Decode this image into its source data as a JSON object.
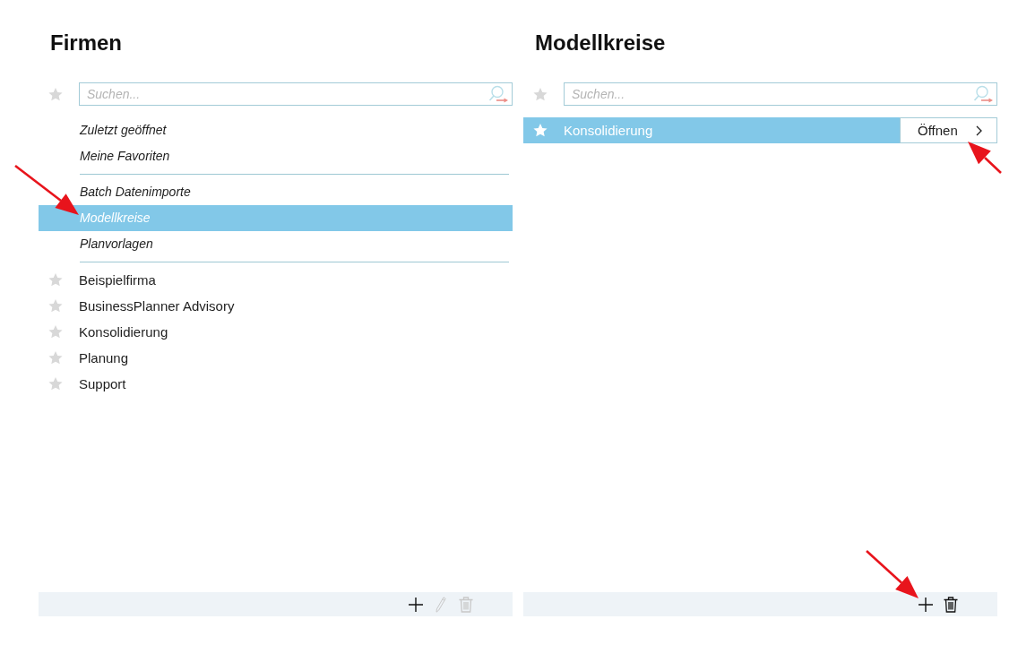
{
  "panels": [
    {
      "title": "Firmen",
      "search": {
        "placeholder": "Suchen...",
        "favorites_only": false
      },
      "nav_groups": [
        [
          {
            "label": "Zuletzt geöffnet",
            "selected": false
          },
          {
            "label": "Meine Favoriten",
            "selected": false
          }
        ],
        [
          {
            "label": "Batch Datenimporte",
            "selected": false
          },
          {
            "label": "Modellkreise",
            "selected": true
          },
          {
            "label": "Planvorlagen",
            "selected": false
          }
        ]
      ],
      "items": [
        {
          "label": "Beispielfirma",
          "starred": false,
          "selected": false
        },
        {
          "label": "BusinessPlanner Advisory",
          "starred": false,
          "selected": false
        },
        {
          "label": "Konsolidierung",
          "starred": false,
          "selected": false
        },
        {
          "label": "Planung",
          "starred": false,
          "selected": false
        },
        {
          "label": "Support",
          "starred": false,
          "selected": false
        }
      ],
      "toolbar": [
        {
          "kind": "add",
          "disabled": false
        },
        {
          "kind": "edit",
          "disabled": true
        },
        {
          "kind": "delete",
          "disabled": true
        }
      ]
    },
    {
      "title": "Modellkreise",
      "search": {
        "placeholder": "Suchen...",
        "favorites_only": false
      },
      "items": [
        {
          "label": "Konsolidierung",
          "starred": false,
          "selected": true,
          "action": "Öffnen"
        }
      ],
      "toolbar": [
        {
          "kind": "add",
          "disabled": false
        },
        {
          "kind": "delete",
          "disabled": false
        }
      ]
    }
  ]
}
